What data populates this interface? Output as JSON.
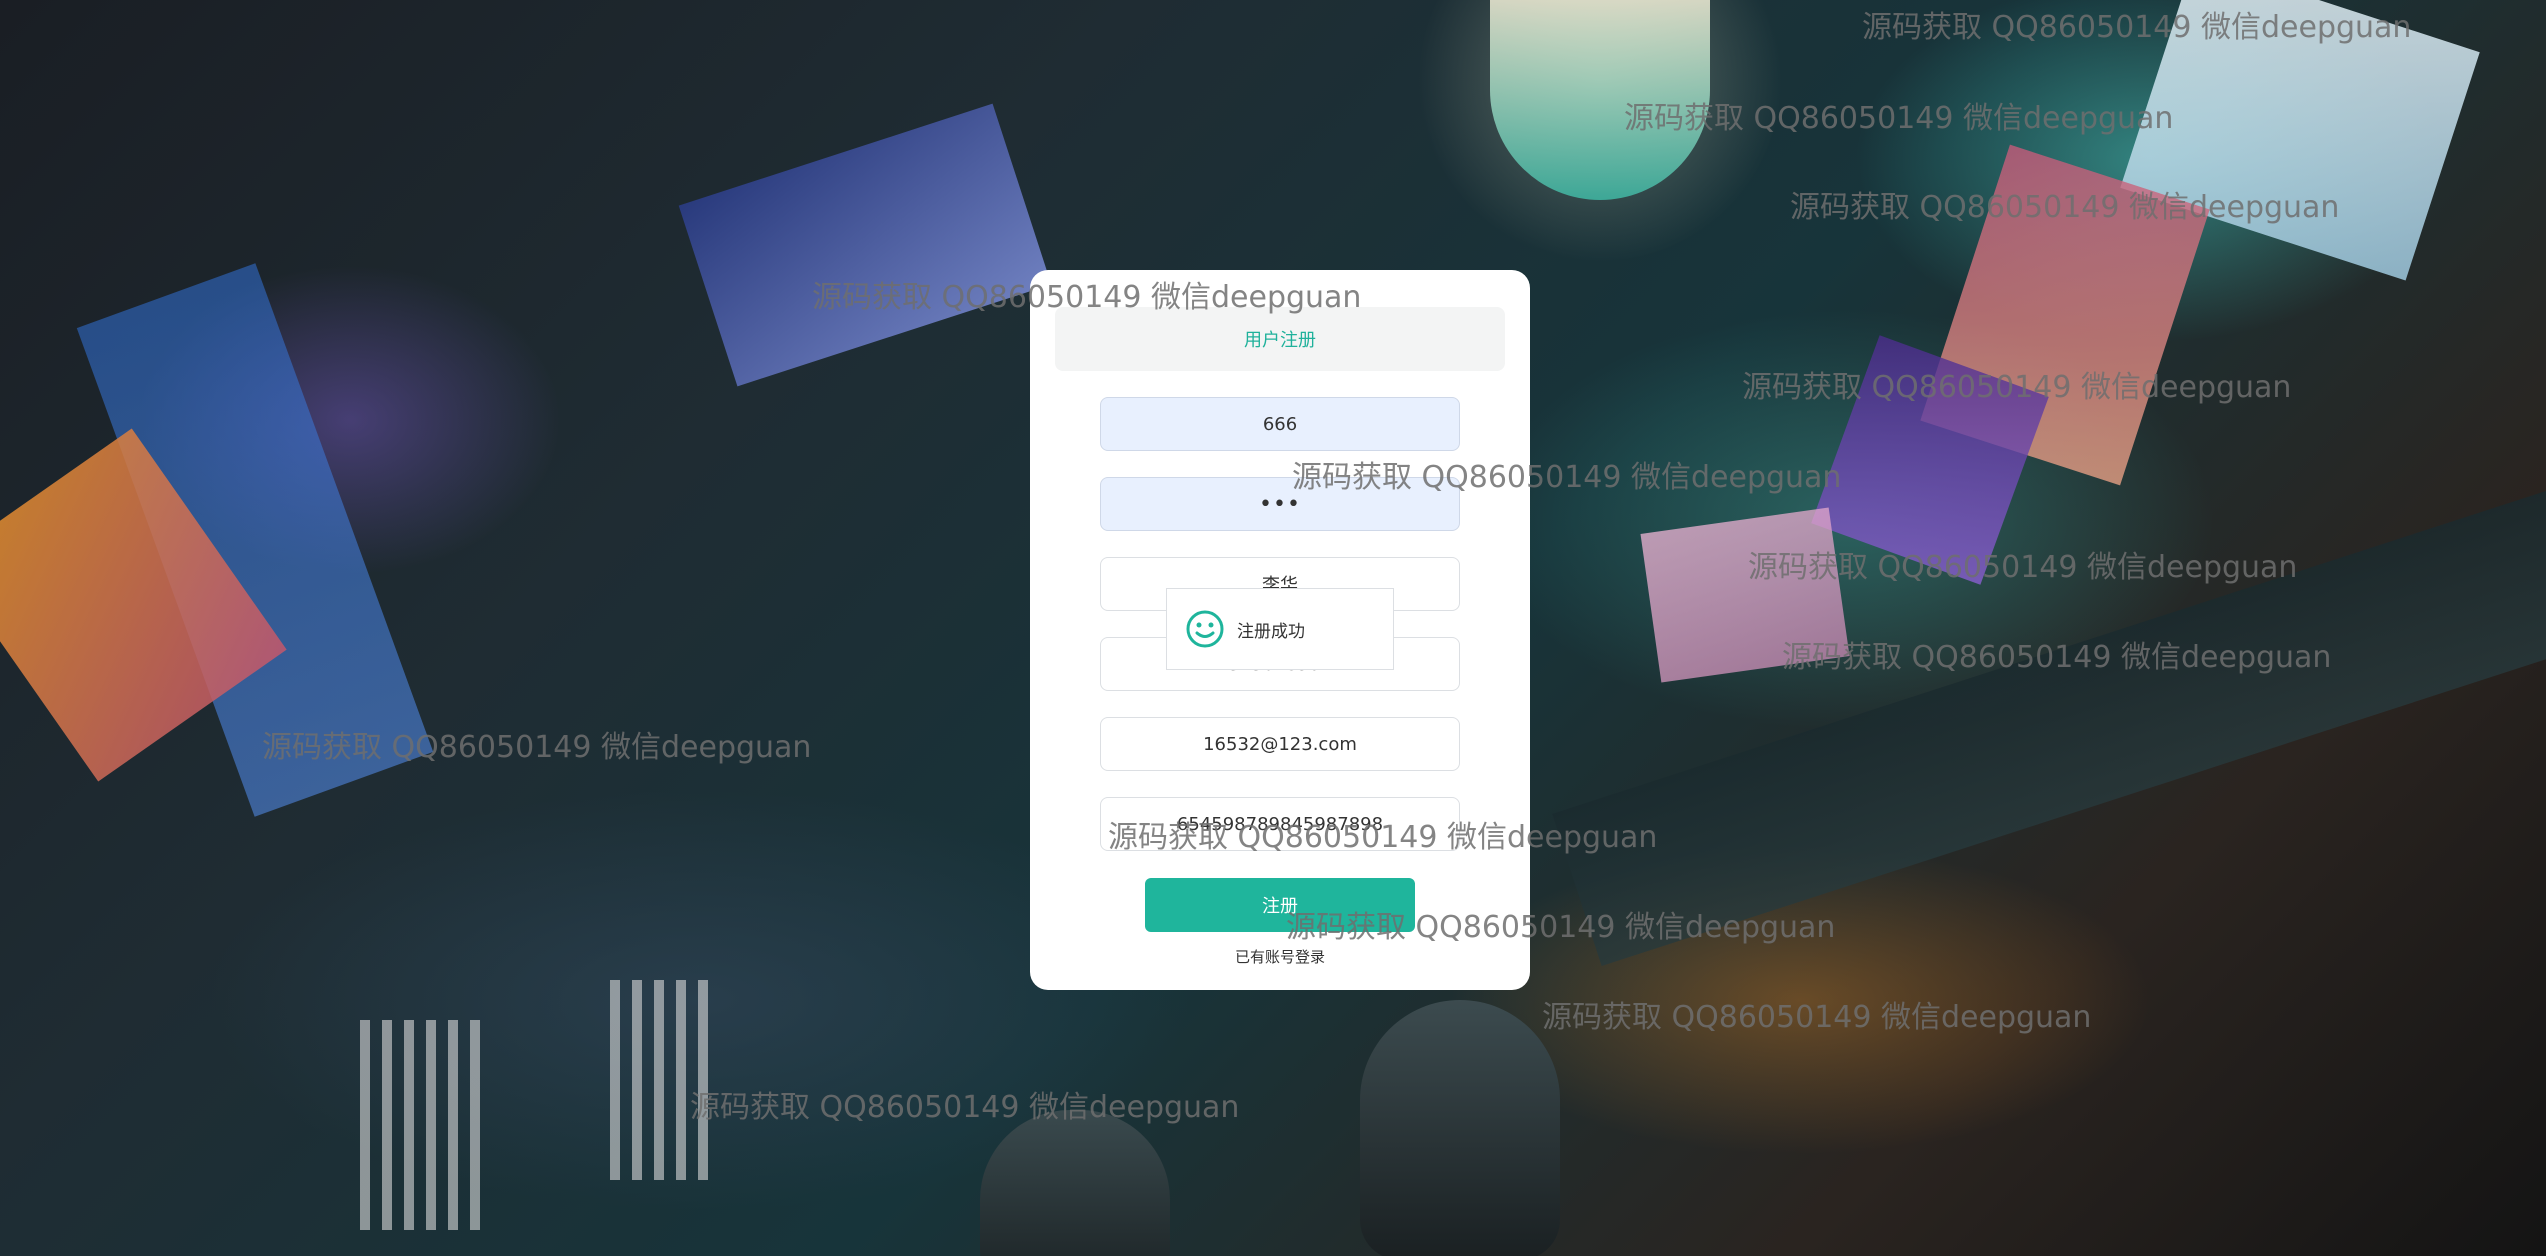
{
  "register": {
    "title": "用户注册",
    "fields": {
      "username": "666",
      "password": "•••",
      "name": "李华",
      "phone": "13456789012",
      "email": "16532@123.com",
      "idcard": "654598789845987898"
    },
    "submit_label": "注册",
    "login_link": "已有账号登录"
  },
  "toast": {
    "message": "注册成功",
    "icon": "smile-icon",
    "color": "#1fb59c"
  },
  "watermark": "源码获取 QQ86050149 微信deepguan",
  "colors": {
    "accent": "#1fb59c",
    "input_autofill": "#e8f0fe"
  }
}
